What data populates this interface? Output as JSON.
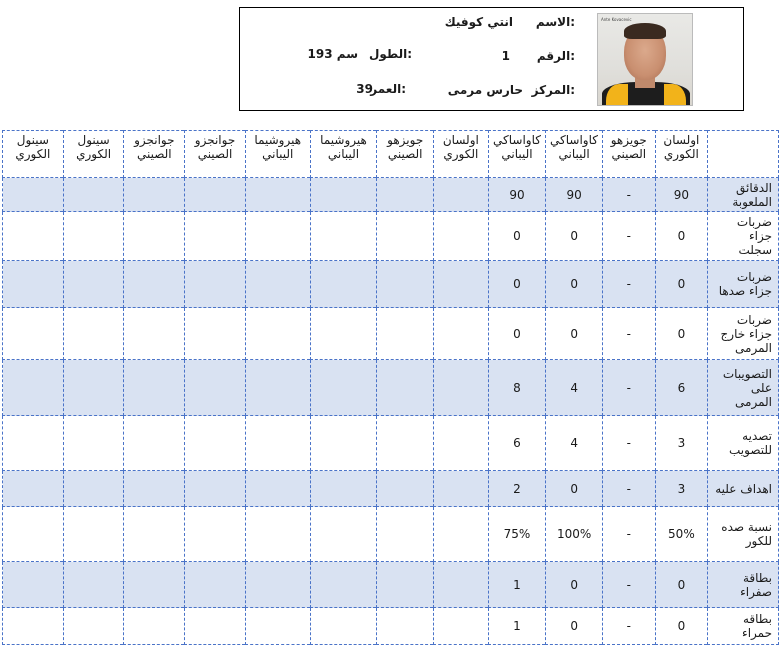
{
  "player": {
    "name_label": "الاسم:",
    "name": "انتي كوفيك",
    "number_label": "الرقم:",
    "number": "1",
    "height_label": "الطول:",
    "height": "193 سم",
    "position_label": "المركز:",
    "position": "حارس مرمى",
    "age_label": "العمر:",
    "age": "39",
    "photo_caption": "Ante Kovacevic"
  },
  "table": {
    "headers": [
      "",
      "اولسان الكوري",
      "جويزهو الصيني",
      "كاواساكي اليباني",
      "كاواساكي اليباني",
      "اولسان الكوري",
      "جويزهو الصيني",
      "هيروشيما اليباني",
      "هيروشيما اليباني",
      "جوانجزو الصيني",
      "جوانجزو الصيني",
      "سينول الكوري",
      "سينول الكوري"
    ],
    "rows": [
      {
        "label": "الدقائق الملعوبة",
        "cells": [
          "90",
          "-",
          "90",
          "90",
          "",
          "",
          "",
          "",
          "",
          "",
          "",
          ""
        ]
      },
      {
        "label": "ضربات جزاء سجلت",
        "cells": [
          "0",
          "-",
          "0",
          "0",
          "",
          "",
          "",
          "",
          "",
          "",
          "",
          ""
        ]
      },
      {
        "label": "ضربات جزاء صدها",
        "cells": [
          "0",
          "-",
          "0",
          "0",
          "",
          "",
          "",
          "",
          "",
          "",
          "",
          ""
        ]
      },
      {
        "label": "ضربات جزاء خارج المرمى",
        "cells": [
          "0",
          "-",
          "0",
          "0",
          "",
          "",
          "",
          "",
          "",
          "",
          "",
          ""
        ]
      },
      {
        "label": "التصويبات على المرمى",
        "cells": [
          "6",
          "-",
          "4",
          "8",
          "",
          "",
          "",
          "",
          "",
          "",
          "",
          ""
        ]
      },
      {
        "label": "تصديه للتصويب",
        "cells": [
          "3",
          "-",
          "4",
          "6",
          "",
          "",
          "",
          "",
          "",
          "",
          "",
          ""
        ]
      },
      {
        "label": "اهداف عليه",
        "cells": [
          "3",
          "-",
          "0",
          "2",
          "",
          "",
          "",
          "",
          "",
          "",
          "",
          ""
        ]
      },
      {
        "label": "نسبة صده للكور",
        "cells": [
          "50%",
          "-",
          "100%",
          "75%",
          "",
          "",
          "",
          "",
          "",
          "",
          "",
          ""
        ]
      },
      {
        "label": "بطاقة صفراء",
        "cells": [
          "0",
          "-",
          "0",
          "1",
          "",
          "",
          "",
          "",
          "",
          "",
          "",
          ""
        ]
      },
      {
        "label": "بطاقه حمراء",
        "cells": [
          "0",
          "-",
          "0",
          "1",
          "",
          "",
          "",
          "",
          "",
          "",
          "",
          ""
        ]
      }
    ]
  },
  "colors": {
    "grid": "#4a73c8",
    "shade": "#d9e2f2"
  }
}
